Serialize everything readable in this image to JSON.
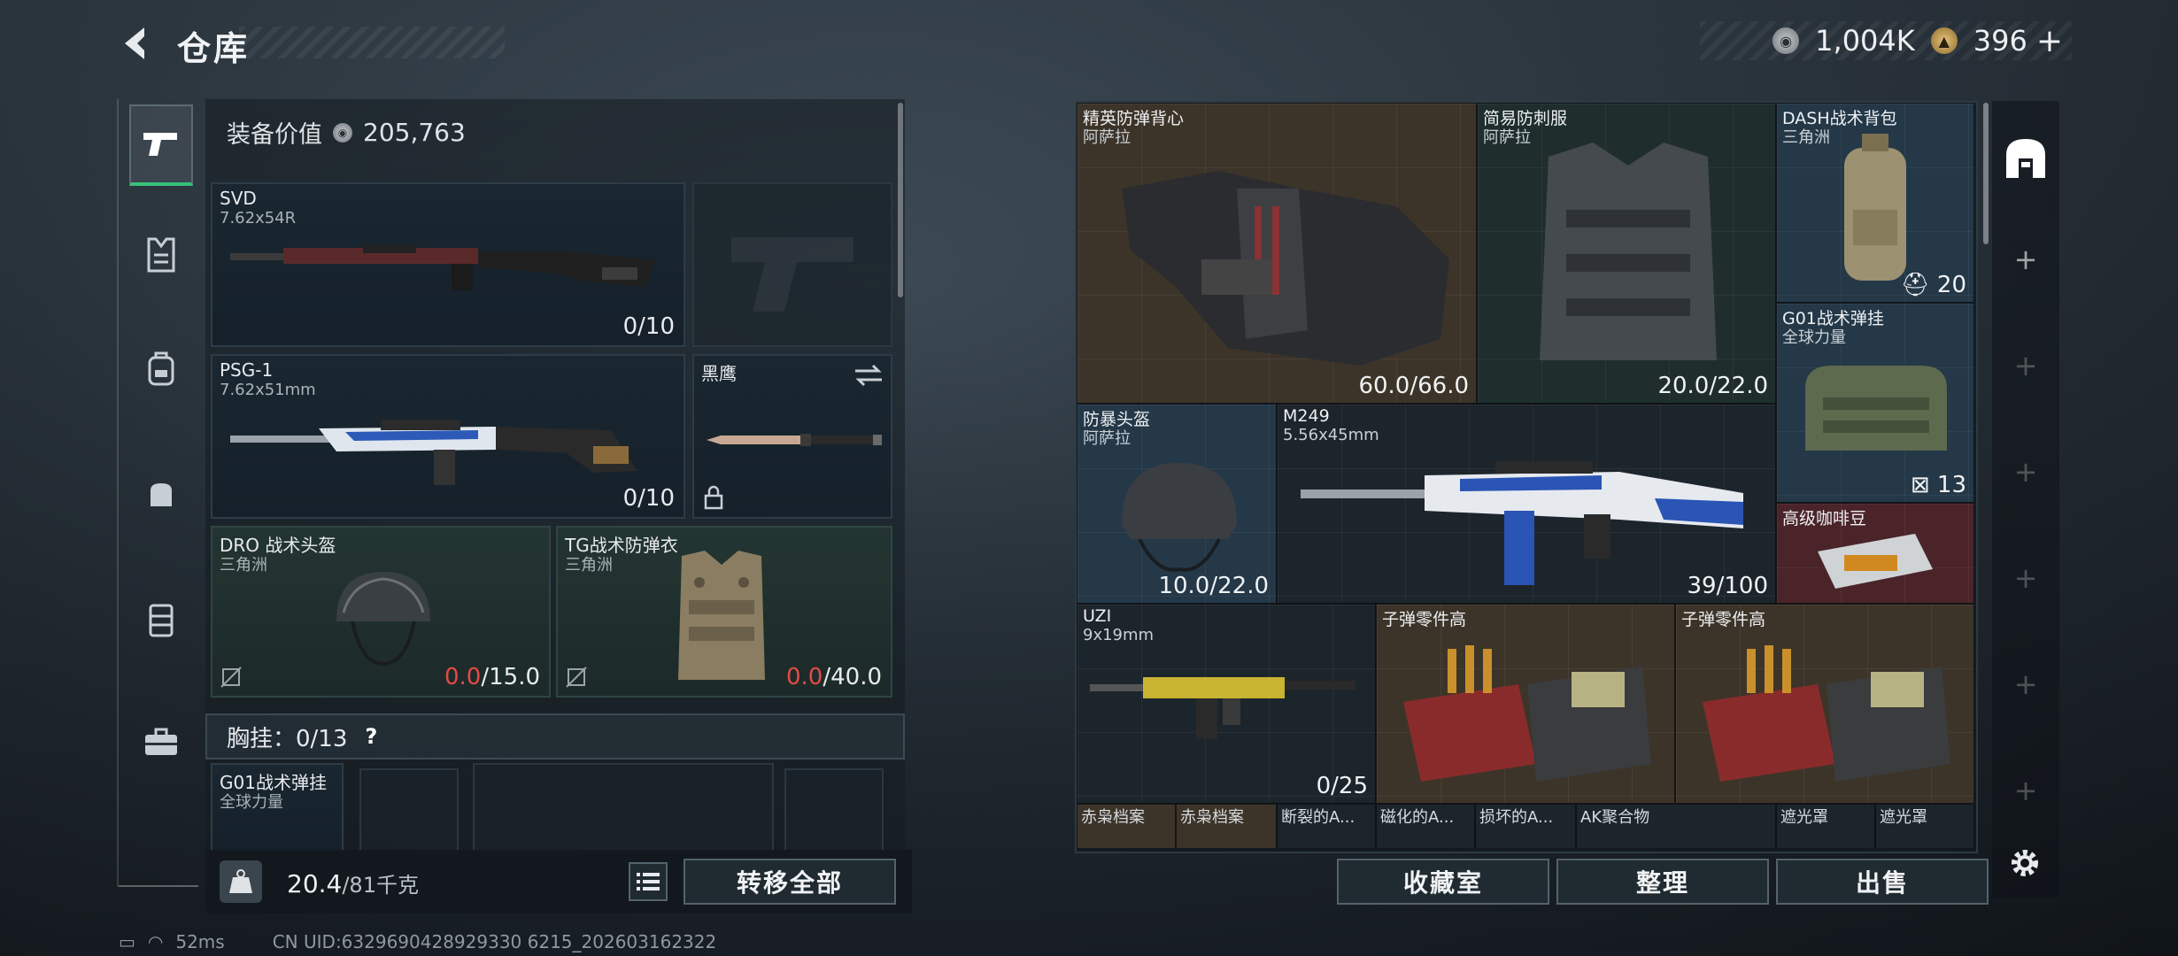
{
  "header": {
    "title": "仓库"
  },
  "currency": {
    "silver_value": "1,004K",
    "gold_value": "396",
    "gold_plus": "+",
    "version": ""
  },
  "equipment": {
    "value_label": "装备价值",
    "value": "205,763",
    "slots": [
      {
        "name": "SVD",
        "sub": "7.62x54R",
        "count": "0/10"
      },
      {
        "name": "PSG-1",
        "sub": "7.62x51mm",
        "count": "0/10"
      },
      {
        "name": "黑鹰",
        "sub": ""
      },
      {
        "name": "DRO 战术头盔",
        "sub": "三角洲",
        "dur_current": "0.0",
        "dur_max": "/15.0"
      },
      {
        "name": "TG战术防弹衣",
        "sub": "三角洲",
        "dur_current": "0.0",
        "dur_max": "/40.0"
      }
    ],
    "chest_rig_label": "胸挂：0/13",
    "chest_rig_help": "?",
    "chest_rig_item": {
      "name": "G01战术弹挂",
      "sub": "全球力量"
    }
  },
  "footer_left": {
    "weight_current": "20.4",
    "weight_max": "/81千克",
    "transfer_all": "转移全部"
  },
  "stash": {
    "items": [
      {
        "name": "精英防弹背心",
        "sub": "阿萨拉",
        "count": "60.0/66.0"
      },
      {
        "name": "简易防刺服",
        "sub": "阿萨拉",
        "count": "20.0/22.0"
      },
      {
        "name": "DASH战术背包",
        "sub": "三角洲",
        "count": "20"
      },
      {
        "name": "G01战术弹挂",
        "sub": "全球力量",
        "count": "13"
      },
      {
        "name": "防暴头盔",
        "sub": "阿萨拉",
        "count": "10.0/22.0"
      },
      {
        "name": "M249",
        "sub": "5.56x45mm",
        "count": "39/100"
      },
      {
        "name": "高级咖啡豆",
        "sub": ""
      },
      {
        "name": "UZI",
        "sub": "9x19mm",
        "count": "0/25"
      },
      {
        "name": "子弹零件高",
        "sub": ""
      },
      {
        "name": "子弹零件高",
        "sub": ""
      }
    ],
    "bottom_row": [
      "赤枭档案",
      "赤枭档案",
      "断裂的A...",
      "磁化的A...",
      "损坏的A...",
      "AK聚合物",
      "遮光罩",
      "遮光罩"
    ]
  },
  "footer_right": {
    "collection": "收藏室",
    "organize": "整理",
    "sell": "出售"
  },
  "status": {
    "ping": "52ms",
    "uid": "CN UID:6329690428929330 6215_202603162322"
  },
  "colors": {
    "accent_green": "#36c17a",
    "durability_red": "#e34a43"
  }
}
